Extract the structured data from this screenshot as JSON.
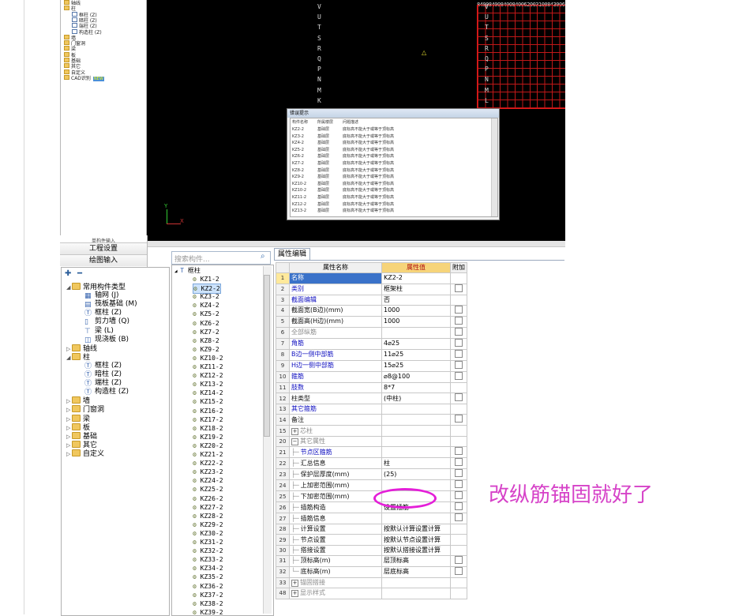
{
  "top_tree": {
    "items": [
      {
        "label": "轴线",
        "indent": 0
      },
      {
        "label": "柱",
        "indent": 0
      },
      {
        "label": "框柱 (Z)",
        "indent": 1
      },
      {
        "label": "暗柱 (Z)",
        "indent": 1
      },
      {
        "label": "端柱 (Z)",
        "indent": 1
      },
      {
        "label": "构造柱 (Z)",
        "indent": 1
      },
      {
        "label": "墙",
        "indent": 0
      },
      {
        "label": "门窗洞",
        "indent": 0
      },
      {
        "label": "梁",
        "indent": 0
      },
      {
        "label": "板",
        "indent": 0
      },
      {
        "label": "基础",
        "indent": 0
      },
      {
        "label": "其它",
        "indent": 0
      },
      {
        "label": "自定义",
        "indent": 0
      },
      {
        "label": "CAD识别",
        "indent": 0
      }
    ],
    "new_badge": "NEW"
  },
  "cad": {
    "axis_letters_left": [
      "V",
      "U",
      "T",
      "S",
      "R",
      "Q",
      "P",
      "N",
      "M",
      "K"
    ],
    "axis_letters_right": [
      "V",
      "U",
      "T",
      "S",
      "R",
      "Q",
      "P",
      "N",
      "M",
      "L"
    ],
    "top_dims": "840084008400840062003100843006840084008400840084008400",
    "ucs_y": "Y",
    "ucs_x": "X"
  },
  "error_dialog": {
    "title": "错误提示",
    "columns": [
      "构件名称",
      "所属楼层",
      "问题描述"
    ],
    "rows": [
      [
        "KZ2-2",
        "基础层",
        "底标高不能大于或等于顶标高"
      ],
      [
        "KZ3-2",
        "基础层",
        "底标高不能大于或等于顶标高"
      ],
      [
        "KZ4-2",
        "基础层",
        "底标高不能大于或等于顶标高"
      ],
      [
        "KZ5-2",
        "基础层",
        "底标高不能大于或等于顶标高"
      ],
      [
        "KZ6-2",
        "基础层",
        "底标高不能大于或等于顶标高"
      ],
      [
        "KZ7-2",
        "基础层",
        "底标高不能大于或等于顶标高"
      ],
      [
        "KZ8-2",
        "基础层",
        "底标高不能大于或等于顶标高"
      ],
      [
        "KZ9-2",
        "基础层",
        "底标高不能大于或等于顶标高"
      ],
      [
        "KZ10-2",
        "基础层",
        "底标高不能大于或等于顶标高"
      ],
      [
        "KZ10-2",
        "基础层",
        "底标高不能大于或等于顶标高"
      ],
      [
        "KZ11-2",
        "基础层",
        "底标高不能大于或等于顶标高"
      ],
      [
        "KZ12-2",
        "基础层",
        "底标高不能大于或等于顶标高"
      ],
      [
        "KZ13-2",
        "基础层",
        "底标高不能大于或等于顶标高"
      ]
    ]
  },
  "nav": {
    "tiny_label": "单构件输入",
    "project_settings": "工程设置",
    "drawing_input": "绘图输入"
  },
  "nav_tree": [
    {
      "label": "常用构件类型",
      "indent": 0,
      "toggle": "◢",
      "icon": "folder-icon"
    },
    {
      "label": "轴网 (J)",
      "indent": 1,
      "toggle": "",
      "icon": "grid-icon"
    },
    {
      "label": "筏板基础 (M)",
      "indent": 1,
      "toggle": "",
      "icon": "raft-icon"
    },
    {
      "label": "框柱 (Z)",
      "indent": 1,
      "toggle": "",
      "icon": "column-icon"
    },
    {
      "label": "剪力墙 (Q)",
      "indent": 1,
      "toggle": "",
      "icon": "wall-icon"
    },
    {
      "label": "梁 (L)",
      "indent": 1,
      "toggle": "",
      "icon": "beam-icon"
    },
    {
      "label": "现浇板 (B)",
      "indent": 1,
      "toggle": "",
      "icon": "slab-icon"
    },
    {
      "label": "轴线",
      "indent": 0,
      "toggle": "▷",
      "icon": "folder-icon"
    },
    {
      "label": "柱",
      "indent": 0,
      "toggle": "◢",
      "icon": "folder-icon"
    },
    {
      "label": "框柱 (Z)",
      "indent": 1,
      "toggle": "",
      "icon": "column-icon"
    },
    {
      "label": "暗柱 (Z)",
      "indent": 1,
      "toggle": "",
      "icon": "column-icon"
    },
    {
      "label": "端柱 (Z)",
      "indent": 1,
      "toggle": "",
      "icon": "column-icon"
    },
    {
      "label": "构造柱 (Z)",
      "indent": 1,
      "toggle": "",
      "icon": "column-icon"
    },
    {
      "label": "墙",
      "indent": 0,
      "toggle": "▷",
      "icon": "folder-icon"
    },
    {
      "label": "门窗洞",
      "indent": 0,
      "toggle": "▷",
      "icon": "folder-icon"
    },
    {
      "label": "梁",
      "indent": 0,
      "toggle": "▷",
      "icon": "folder-icon"
    },
    {
      "label": "板",
      "indent": 0,
      "toggle": "▷",
      "icon": "folder-icon"
    },
    {
      "label": "基础",
      "indent": 0,
      "toggle": "▷",
      "icon": "folder-icon"
    },
    {
      "label": "其它",
      "indent": 0,
      "toggle": "▷",
      "icon": "folder-icon"
    },
    {
      "label": "自定义",
      "indent": 0,
      "toggle": "▷",
      "icon": "folder-icon"
    }
  ],
  "search": {
    "placeholder": "搜索构件..."
  },
  "component_list": {
    "root": "框柱",
    "items": [
      "KZ1-2",
      "KZ2-2",
      "KZ3-2",
      "KZ4-2",
      "KZ5-2",
      "KZ6-2",
      "KZ7-2",
      "KZ8-2",
      "KZ9-2",
      "KZ10-2",
      "KZ11-2",
      "KZ12-2",
      "KZ13-2",
      "KZ14-2",
      "KZ15-2",
      "KZ16-2",
      "KZ17-2",
      "KZ18-2",
      "KZ19-2",
      "KZ20-2",
      "KZ21-2",
      "KZ22-2",
      "KZ23-2",
      "KZ24-2",
      "KZ25-2",
      "KZ26-2",
      "KZ27-2",
      "KZ28-2",
      "KZ29-2",
      "KZ30-2",
      "KZ31-2",
      "KZ32-2",
      "KZ33-2",
      "KZ34-2",
      "KZ35-2",
      "KZ36-2",
      "KZ37-2",
      "KZ38-2",
      "KZ39-2"
    ],
    "selected": "KZ2-2"
  },
  "property_tab": "属性编辑",
  "property_headers": {
    "name": "属性名称",
    "value": "属性值",
    "extra": "附加"
  },
  "properties": [
    {
      "n": "1",
      "name": "名称",
      "value": "KZ2-2",
      "chk": false,
      "style": "nm",
      "pm": "",
      "tree": "",
      "sel": true
    },
    {
      "n": "2",
      "name": "类别",
      "value": "框架柱",
      "chk": true,
      "style": "nm",
      "pm": "",
      "tree": ""
    },
    {
      "n": "3",
      "name": "截面编辑",
      "value": "否",
      "chk": false,
      "style": "nm",
      "pm": "",
      "tree": ""
    },
    {
      "n": "4",
      "name": "截面宽(B边)(mm)",
      "value": "1000",
      "chk": true,
      "style": "blk",
      "pm": "",
      "tree": ""
    },
    {
      "n": "5",
      "name": "截面高(H边)(mm)",
      "value": "1000",
      "chk": true,
      "style": "blk",
      "pm": "",
      "tree": ""
    },
    {
      "n": "6",
      "name": "全部纵筋",
      "value": "",
      "chk": true,
      "style": "gray",
      "pm": "",
      "tree": ""
    },
    {
      "n": "7",
      "name": "角筋",
      "value": "4⌀25",
      "chk": true,
      "style": "nm",
      "pm": "",
      "tree": ""
    },
    {
      "n": "8",
      "name": "B边一侧中部筋",
      "value": "11⌀25",
      "chk": true,
      "style": "nm",
      "pm": "",
      "tree": ""
    },
    {
      "n": "9",
      "name": "H边一侧中部筋",
      "value": "15⌀25",
      "chk": true,
      "style": "nm",
      "pm": "",
      "tree": ""
    },
    {
      "n": "10",
      "name": "箍筋",
      "value": "⌀8@100",
      "chk": true,
      "style": "nm",
      "pm": "",
      "tree": ""
    },
    {
      "n": "11",
      "name": "肢数",
      "value": "8*7",
      "chk": false,
      "style": "nm",
      "pm": "",
      "tree": ""
    },
    {
      "n": "12",
      "name": "柱类型",
      "value": "(中柱)",
      "chk": true,
      "style": "blk",
      "pm": "",
      "tree": ""
    },
    {
      "n": "13",
      "name": "其它箍筋",
      "value": "",
      "chk": false,
      "style": "nm",
      "pm": "",
      "tree": ""
    },
    {
      "n": "14",
      "name": "备注",
      "value": "",
      "chk": true,
      "style": "blk",
      "pm": "",
      "tree": ""
    },
    {
      "n": "15",
      "name": "芯柱",
      "value": "",
      "chk": false,
      "style": "gray",
      "pm": "+",
      "tree": ""
    },
    {
      "n": "20",
      "name": "其它属性",
      "value": "",
      "chk": false,
      "style": "gray",
      "pm": "−",
      "tree": ""
    },
    {
      "n": "21",
      "name": "节点区箍筋",
      "value": "",
      "chk": true,
      "style": "nm",
      "pm": "",
      "tree": "├─"
    },
    {
      "n": "22",
      "name": "汇总信息",
      "value": "柱",
      "chk": true,
      "style": "blk",
      "pm": "",
      "tree": "├─"
    },
    {
      "n": "23",
      "name": "保护层厚度(mm)",
      "value": "(25)",
      "chk": true,
      "style": "blk",
      "pm": "",
      "tree": "├─"
    },
    {
      "n": "24",
      "name": "上加密范围(mm)",
      "value": "",
      "chk": true,
      "style": "blk",
      "pm": "",
      "tree": "├─"
    },
    {
      "n": "25",
      "name": "下加密范围(mm)",
      "value": "",
      "chk": true,
      "style": "blk",
      "pm": "",
      "tree": "├─"
    },
    {
      "n": "26",
      "name": "插筋构造",
      "value": "设置插筋",
      "chk": true,
      "style": "blk",
      "pm": "",
      "tree": "├─"
    },
    {
      "n": "27",
      "name": "插筋信息",
      "value": "",
      "chk": true,
      "style": "blk",
      "pm": "",
      "tree": "├─"
    },
    {
      "n": "28",
      "name": "计算设置",
      "value": "按默认计算设置计算",
      "chk": false,
      "style": "blk",
      "pm": "",
      "tree": "├─"
    },
    {
      "n": "29",
      "name": "节点设置",
      "value": "按默认节点设置计算",
      "chk": false,
      "style": "blk",
      "pm": "",
      "tree": "├─"
    },
    {
      "n": "30",
      "name": "搭接设置",
      "value": "按默认搭接设置计算",
      "chk": false,
      "style": "blk",
      "pm": "",
      "tree": "├─"
    },
    {
      "n": "31",
      "name": "顶标高(m)",
      "value": "层顶标高",
      "chk": true,
      "style": "blk",
      "pm": "",
      "tree": "├─"
    },
    {
      "n": "32",
      "name": "底标高(m)",
      "value": "层底标高",
      "chk": true,
      "style": "blk",
      "pm": "",
      "tree": "└─"
    },
    {
      "n": "33",
      "name": "锚固搭接",
      "value": "",
      "chk": false,
      "style": "gray",
      "pm": "+",
      "tree": ""
    },
    {
      "n": "48",
      "name": "显示样式",
      "value": "",
      "chk": false,
      "style": "gray",
      "pm": "+",
      "tree": ""
    }
  ],
  "annotation": "改纵筋锚固就好了",
  "colors": {
    "annotation": "#d642c8",
    "oval": "#e41fd8",
    "selection": "#3a72c9",
    "value_header": "#f6d47a"
  }
}
